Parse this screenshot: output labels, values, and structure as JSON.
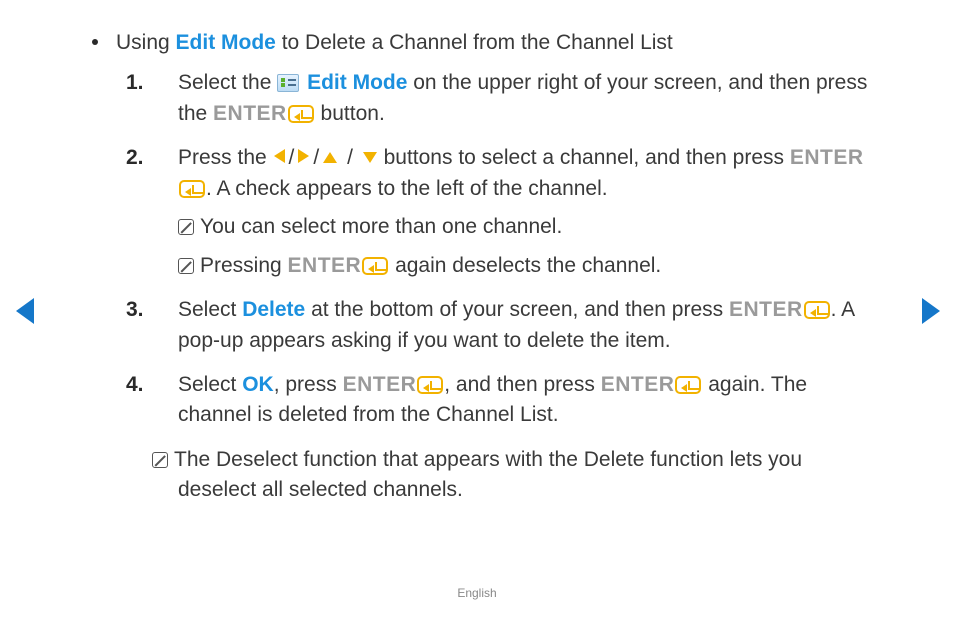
{
  "heading": {
    "prefix": "Using ",
    "link": "Edit Mode",
    "suffix": " to Delete a Channel from the Channel List"
  },
  "steps": [
    {
      "num": "1.",
      "t1": "Select the ",
      "link": "Edit Mode",
      "t2": " on the upper right of your screen, and then press the ",
      "enter": "ENTER",
      "t3": " button."
    },
    {
      "num": "2.",
      "t1": "Press the ",
      "t2": " buttons to select a channel, and then press ",
      "enter": "ENTER",
      "t3": ". A check appears to the left of the channel.",
      "notes": [
        "You can select more than one channel.",
        {
          "a": "Pressing ",
          "enter": "ENTER",
          "b": " again deselects the channel."
        }
      ]
    },
    {
      "num": "3.",
      "t1": "Select ",
      "link": "Delete",
      "t2": " at the bottom of your screen, and then press ",
      "enter": "ENTER",
      "t3": ". A pop-up appears asking if you want to delete the item."
    },
    {
      "num": "4.",
      "t1": "Select ",
      "link": "OK",
      "t2": ", press ",
      "enter": "ENTER",
      "t3": ", and then press ",
      "enter2": "ENTER",
      "t4": " again. The channel is deleted from the Channel List."
    }
  ],
  "outerNote": "The Deselect function that appears with the Delete function lets you deselect all selected channels.",
  "slash": "/",
  "footer": "English"
}
